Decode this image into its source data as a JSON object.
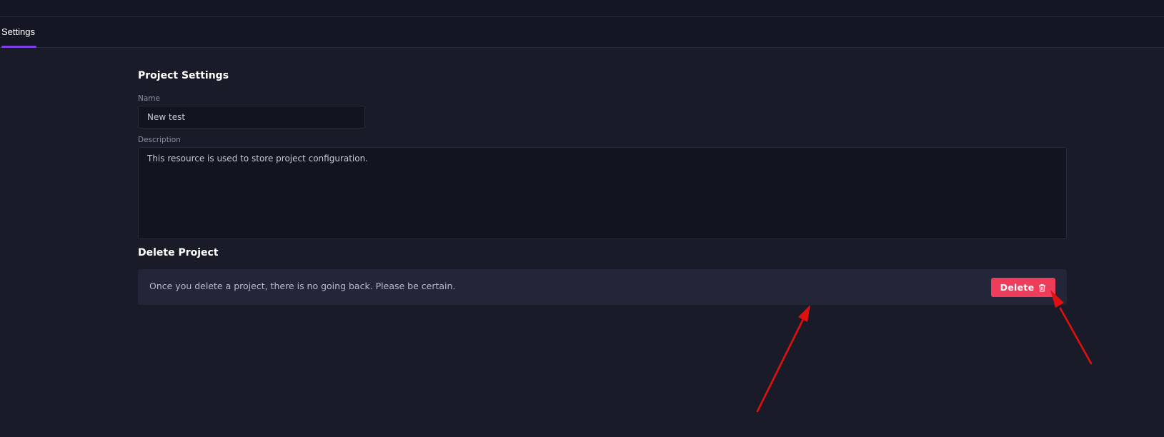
{
  "tabs": [
    {
      "label": "Settings",
      "active": true
    }
  ],
  "project_settings": {
    "title": "Project Settings",
    "name_label": "Name",
    "name_value": "New test",
    "description_label": "Description",
    "description_value": "This resource is used to store project configuration."
  },
  "delete_project": {
    "title": "Delete Project",
    "warning_text": "Once you delete a project, there is no going back. Please be certain.",
    "button_label": "Delete",
    "button_icon": "trash-icon"
  },
  "colors": {
    "accent": "#7b3fe4",
    "danger": "#ee3c5b",
    "background": "#191c28",
    "annotation": "#e01010"
  }
}
